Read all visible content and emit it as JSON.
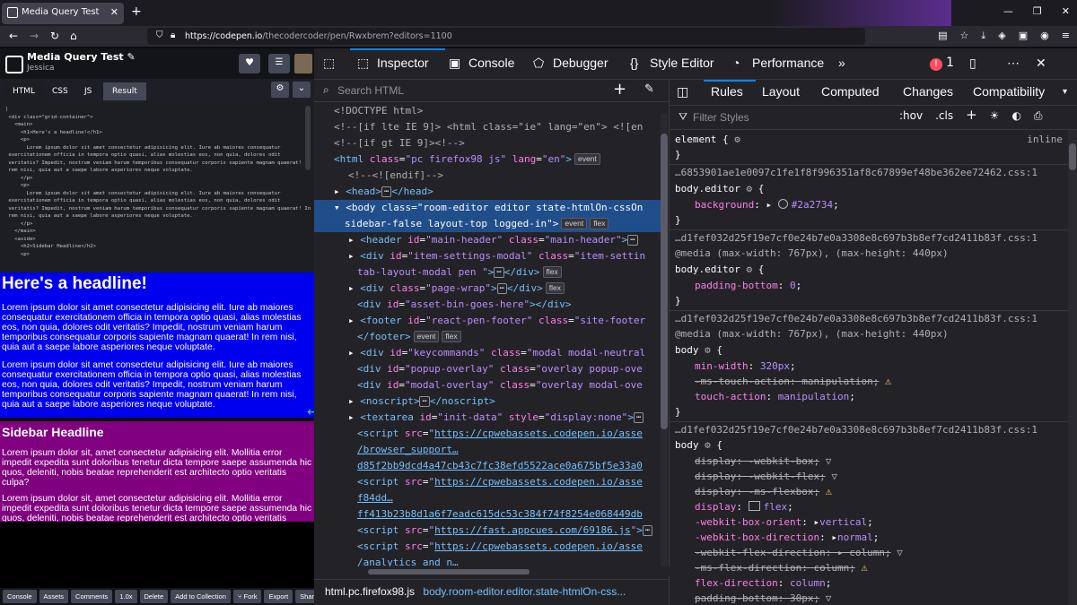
{
  "browser": {
    "tab_title": "Media Query Test",
    "url_host": "https://codepen.io",
    "url_path": "/thecodercoder/pen/Rwxbrem?editors=1100"
  },
  "codepen": {
    "title": "Media Query Test",
    "user": "Jessica",
    "tabs": [
      "HTML",
      "CSS",
      "JS",
      "Result"
    ],
    "html_code": "|\n <div class=\"grid-container\">\n   <main>\n     <h1>Here's a headline!</h1>\n     <p>\n       Lorem ipsum dolor sit amet consectetur adipisicing elit. Iure ab maiores consequatur\n exercitationem officia in tempora optio quasi, alias molestias eos, non quia, dolores odit\n veritatis? Impedit, nostrum veniam harum temporibus consequatur corporis sapiente magnam quaerat! In\n rem nisi, quia aut a saepe labore asperiores neque voluptate.\n     </p>\n     <p>\n       Lorem ipsum dolor sit amet consectetur adipisicing elit. Iure ab maiores consequatur\n exercitationem officia in tempora optio quasi, alias molestias eos, non quia, dolores odit\n veritatis? Impedit, nostrum veniam harum temporibus consequatur corporis sapiente magnam quaerat! In\n rem nisi, quia aut a saepe labore asperiores neque voluptate.\n     </p>\n   </main>\n   <aside>\n     <h2>Sidebar Headline</h2>\n     <p>",
    "preview": {
      "h1": "Here's a headline!",
      "p1": "Lorem ipsum dolor sit amet consectetur adipisicing elit. Iure ab maiores consequatur exercitationem officia in tempora optio quasi, alias molestias eos, non quia, dolores odit veritatis? Impedit, nostrum veniam harum temporibus consequatur corporis sapiente magnam quaerat! In rem nisi, quia aut a saepe labore asperiores neque voluptate.",
      "p2": "Lorem ipsum dolor sit amet consectetur adipisicing elit. Iure ab maiores consequatur exercitationem officia in tempora optio quasi, alias molestias eos, non quia, dolores odit veritatis? Impedit, nostrum veniam harum temporibus consequatur corporis sapiente magnam quaerat! In rem nisi, quia aut a saepe labore asperiores neque voluptate.",
      "h2": "Sidebar Headline",
      "p3": "Lorem ipsum dolor sit, amet consectetur adipisicing elit. Mollitia error impedit expedita sunt doloribus tenetur dicta tempore saepe assumenda hic quos, deleniti, nobis beatae reprehenderit est architecto optio veritatis culpa?",
      "p4": "Lorem ipsum dolor sit, amet consectetur adipisicing elit. Mollitia error impedit expedita sunt doloribus tenetur dicta tempore saepe assumenda hic quos, deleniti, nobis beatae reprehenderit est architecto optio veritatis culpa?"
    },
    "bottom_buttons": [
      "Console",
      "Assets",
      "Comments",
      "1.0x",
      "Delete",
      "Add to Collection",
      "Fork",
      "Export",
      "Share"
    ]
  },
  "devtools": {
    "tabs": [
      "Inspector",
      "Console",
      "Debugger",
      "Style Editor",
      "Performance"
    ],
    "error_count": "1",
    "search_placeholder": "Search HTML",
    "breadcrumb_1": "html.pc.firefox98.js",
    "breadcrumb_2": "body.room-editor.editor.state-htmlOn-css...",
    "rules_tabs": [
      "Rules",
      "Layout",
      "Computed",
      "Changes",
      "Compatibility"
    ],
    "filter_placeholder": "Filter Styles",
    "hov": ":hov",
    "cls": ".cls",
    "element_rule": "element {",
    "inline": "inline",
    "src1": "…6853901ae1e0097c1fe1f8f996351af8c67899ef48be362ee72462.css:1",
    "src2": "…d1fef032d25f19e7cf0e24b7e0a3308e8c697b3b8ef7cd2411b83f.css:1",
    "media": "@media (max-width: 767px), (max-height: 440px)",
    "background_value": "#2a2734"
  },
  "colors": {
    "preview_main_bg": "#0000ee",
    "preview_aside_bg": "#800080",
    "accent": "#0a84ff"
  }
}
